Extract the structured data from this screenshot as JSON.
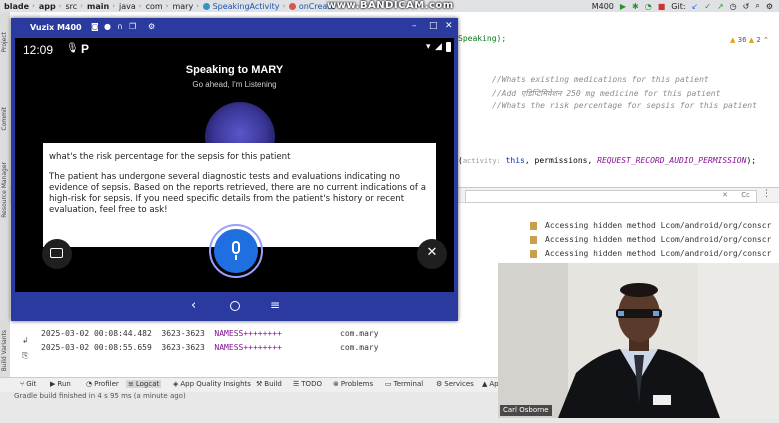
{
  "ide": {
    "breadcrumbs": [
      "blade",
      "app",
      "src",
      "main",
      "java",
      "com",
      "mary",
      "SpeakingActivity",
      "onCreate"
    ],
    "device_selector": "M400",
    "git_label": "Git:",
    "overlay_watermark": "www.BANDICAM.com"
  },
  "editor": {
    "line_fragment": "Speaking);",
    "warnings_count": "36",
    "weak_warnings_count": "2",
    "comment1": "//Whats existing medications for this patient",
    "comment2": "//Add एडिप्टिमिवेशन 250 mg medicine for this patient",
    "comment3": "//Whats the risk percentage for sepsis  for this patient",
    "call_hint": "activity:",
    "call_args": [
      "this",
      "permissions",
      "REQUEST_RECORD_AUDIO_PERMISSION"
    ],
    "call_end": ");"
  },
  "logcat": {
    "filter_placeholder": "",
    "filter_cc": "Cc",
    "hidden_rows": [
      "Accessing hidden method Lcom/android/org/conscr",
      "Accessing hidden method Lcom/android/org/conscr",
      "Accessing hidden method Lcom/android/org/conscr"
    ],
    "rows": [
      {
        "time": "2025-03-02 00:08:44.482",
        "pid": "3623-3623",
        "tag": "NAMESS++++++++",
        "pkg": "com.mary"
      },
      {
        "time": "2025-03-02 00:08:55.659",
        "pid": "3623-3623",
        "tag": "NAMESS++++++++",
        "pkg": "com.mary"
      }
    ]
  },
  "bottom_tools": [
    "Git",
    "Run",
    "Profiler",
    "Logcat",
    "App Quality Insights",
    "Build",
    "TODO",
    "Problems",
    "Terminal",
    "Services",
    "Ap"
  ],
  "status_bar": {
    "text": "Gradle build finished in 4 s 95 ms (a minute ago)"
  },
  "emulator": {
    "window_title": "Vuzix M400",
    "clock": "12:09",
    "heading": "Speaking to MARY",
    "subheading": "Go ahead, I'm Listening",
    "question": "what's the risk percentage for the sepsis for this patient",
    "answer": "The patient has undergone several diagnostic tests and evaluations indicating no evidence of sepsis. Based on the reports retrieved, there are no current indications of a high-risk for sepsis. If you need specific details from the patient's history or recent evaluation, feel free to ask!"
  },
  "webcam": {
    "name": "Carl Osborne"
  },
  "colors": {
    "emu_blue": "#2b3a9e",
    "mic_blue": "#1f6fe0",
    "comment_grey": "#8c8c8c",
    "tag_purple": "#871094"
  },
  "icons": [
    "keyboard-icon",
    "mic-icon",
    "close-icon",
    "back-icon",
    "home-icon",
    "menu-icon",
    "wifi-icon",
    "battery-icon",
    "minimize-icon",
    "maximize-icon",
    "window-close-icon"
  ]
}
